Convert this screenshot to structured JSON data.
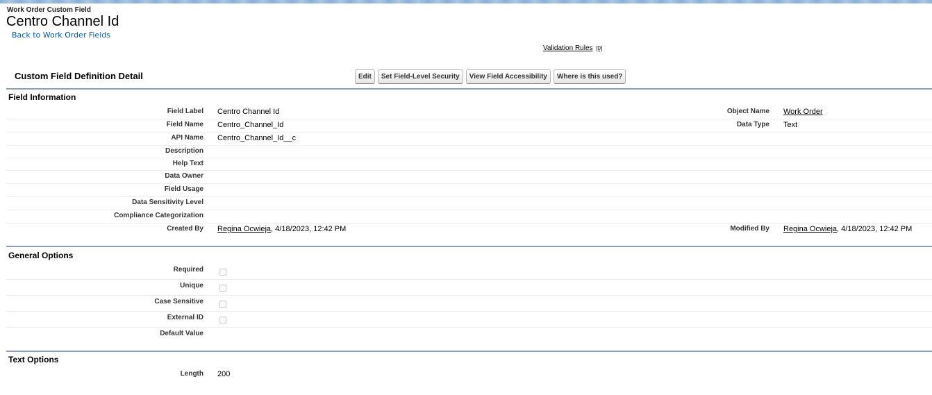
{
  "header": {
    "object_type": "Work Order Custom Field",
    "title": "Centro Channel Id",
    "back_link": "Back to Work Order Fields"
  },
  "related": {
    "validation_rules_label": "Validation Rules",
    "validation_rules_count": "[0]"
  },
  "detail": {
    "heading": "Custom Field Definition Detail",
    "buttons": {
      "edit": "Edit",
      "field_security": "Set Field-Level Security",
      "field_accessibility": "View Field Accessibility",
      "where_used": "Where is this used?"
    }
  },
  "field_information": {
    "title": "Field Information",
    "field_label_label": "Field Label",
    "field_label_value": "Centro Channel Id",
    "object_name_label": "Object Name",
    "object_name_value": "Work Order",
    "field_name_label": "Field Name",
    "field_name_value": "Centro_Channel_Id",
    "data_type_label": "Data Type",
    "data_type_value": "Text",
    "api_name_label": "API Name",
    "api_name_value": "Centro_Channel_Id__c",
    "description_label": "Description",
    "help_text_label": "Help Text",
    "data_owner_label": "Data Owner",
    "field_usage_label": "Field Usage",
    "data_sensitivity_label": "Data Sensitivity Level",
    "compliance_label": "Compliance Categorization",
    "created_by_label": "Created By",
    "created_by_user": "Regina Ocwieja",
    "created_by_date": ", 4/18/2023, 12:42 PM",
    "modified_by_label": "Modified By",
    "modified_by_user": "Regina Ocwieja",
    "modified_by_date": ", 4/18/2023, 12:42 PM"
  },
  "general_options": {
    "title": "General Options",
    "required_label": "Required",
    "required_checked": false,
    "unique_label": "Unique",
    "unique_checked": false,
    "case_sensitive_label": "Case Sensitive",
    "case_sensitive_checked": false,
    "external_id_label": "External ID",
    "external_id_checked": false,
    "default_value_label": "Default Value"
  },
  "text_options": {
    "title": "Text Options",
    "length_label": "Length",
    "length_value": "200"
  }
}
